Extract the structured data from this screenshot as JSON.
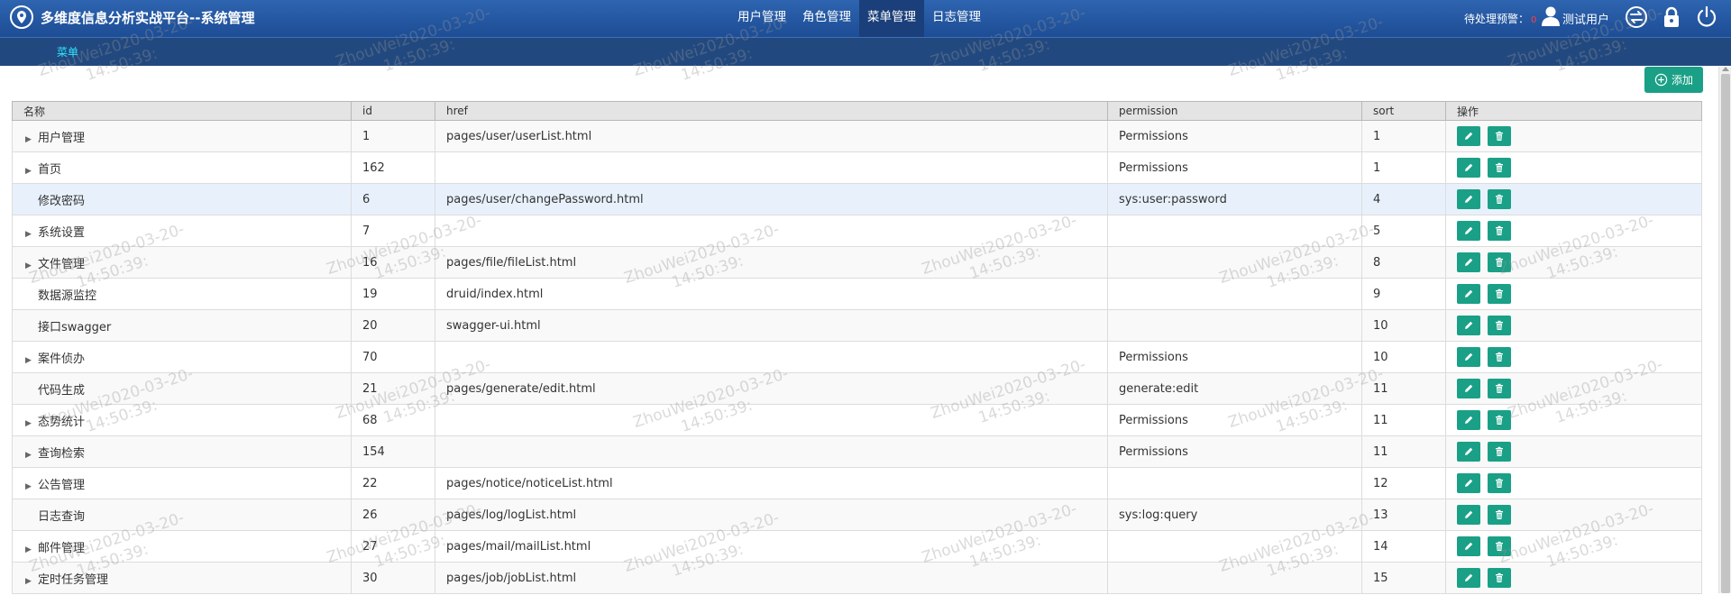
{
  "header": {
    "title": "多维度信息分析实战平台--系统管理",
    "nav": [
      {
        "label": "用户管理",
        "active": false
      },
      {
        "label": "角色管理",
        "active": false
      },
      {
        "label": "菜单管理",
        "active": true
      },
      {
        "label": "日志管理",
        "active": false
      }
    ],
    "pending_label": "待处理预警：",
    "pending_count": "0",
    "user_name": "测试用户",
    "icons": {
      "logo": "location-pin-icon",
      "user": "user-icon",
      "switch": "switch-icon",
      "lock": "lock-icon",
      "power": "power-icon"
    }
  },
  "subnav": {
    "item": "菜单"
  },
  "toolbar": {
    "add_label": "添加"
  },
  "table": {
    "columns": [
      "名称",
      "id",
      "href",
      "permission",
      "sort",
      "操作"
    ],
    "rows": [
      {
        "name": "用户管理",
        "expandable": true,
        "id": "1",
        "href": "pages/user/userList.html",
        "permission": "Permissions",
        "sort": "1"
      },
      {
        "name": "首页",
        "expandable": true,
        "id": "162",
        "href": "",
        "permission": "Permissions",
        "sort": "1"
      },
      {
        "name": "修改密码",
        "expandable": false,
        "id": "6",
        "href": "pages/user/changePassword.html",
        "permission": "sys:user:password",
        "sort": "4"
      },
      {
        "name": "系统设置",
        "expandable": true,
        "id": "7",
        "href": "",
        "permission": "",
        "sort": "5"
      },
      {
        "name": "文件管理",
        "expandable": true,
        "id": "16",
        "href": "pages/file/fileList.html",
        "permission": "",
        "sort": "8"
      },
      {
        "name": "数据源监控",
        "expandable": false,
        "id": "19",
        "href": "druid/index.html",
        "permission": "",
        "sort": "9"
      },
      {
        "name": "接口swagger",
        "expandable": false,
        "id": "20",
        "href": "swagger-ui.html",
        "permission": "",
        "sort": "10"
      },
      {
        "name": "案件侦办",
        "expandable": true,
        "id": "70",
        "href": "",
        "permission": "Permissions",
        "sort": "10"
      },
      {
        "name": "代码生成",
        "expandable": false,
        "id": "21",
        "href": "pages/generate/edit.html",
        "permission": "generate:edit",
        "sort": "11"
      },
      {
        "name": "态势统计",
        "expandable": true,
        "id": "68",
        "href": "",
        "permission": "Permissions",
        "sort": "11"
      },
      {
        "name": "查询检索",
        "expandable": true,
        "id": "154",
        "href": "",
        "permission": "Permissions",
        "sort": "11"
      },
      {
        "name": "公告管理",
        "expandable": true,
        "id": "22",
        "href": "pages/notice/noticeList.html",
        "permission": "",
        "sort": "12"
      },
      {
        "name": "日志查询",
        "expandable": false,
        "id": "26",
        "href": "pages/log/logList.html",
        "permission": "sys:log:query",
        "sort": "13"
      },
      {
        "name": "邮件管理",
        "expandable": true,
        "id": "27",
        "href": "pages/mail/mailList.html",
        "permission": "",
        "sort": "14"
      },
      {
        "name": "定时任务管理",
        "expandable": true,
        "id": "30",
        "href": "pages/job/jobList.html",
        "permission": "",
        "sort": "15"
      }
    ],
    "selected_row": 2,
    "row_actions": {
      "edit": "pencil-icon",
      "delete": "trash-icon"
    }
  },
  "watermark": {
    "line1": "ZhouWei2020-03-20-",
    "line2": "14:50:39:"
  },
  "colors": {
    "header": "#2a5ea8",
    "subbar": "#22497f",
    "accent": "#1aa086",
    "active_sub": "#2ee6ff"
  }
}
